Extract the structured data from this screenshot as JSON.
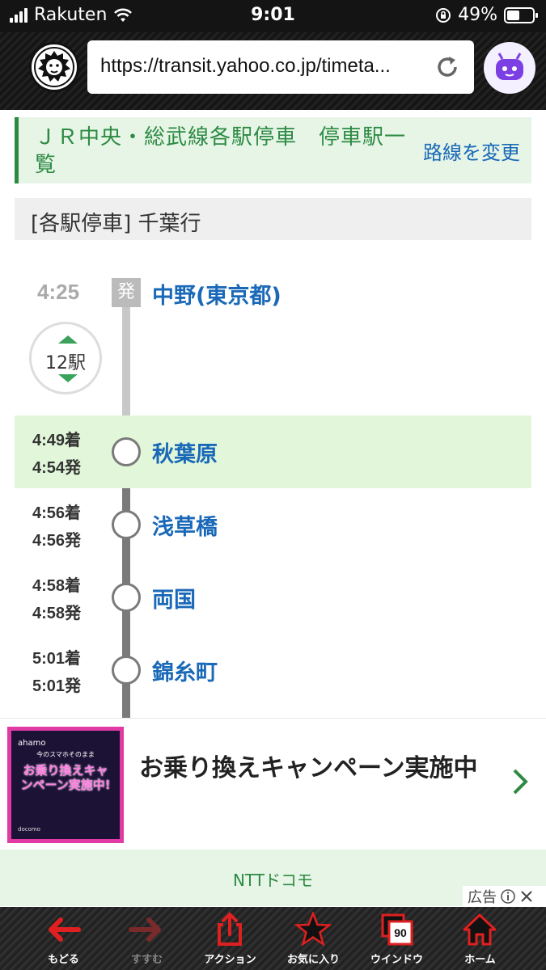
{
  "status_bar": {
    "carrier": "Rakuten",
    "time": "9:01",
    "battery": "49%",
    "battery_level": 0.49
  },
  "browser": {
    "url": "https://transit.yahoo.co.jp/timeta..."
  },
  "route": {
    "title": "ＪＲ中央・総武線各駅停車　停車駅一覧",
    "change_link": "路線を変更",
    "direction": "[各駅停車]  千葉行"
  },
  "departure": {
    "time": "4:25",
    "badge": "発",
    "station": "中野(東京都)",
    "stop_count": "12駅"
  },
  "stops": [
    {
      "arr": "4:49着",
      "dep": "4:54発",
      "name": "秋葉原",
      "highlight": true
    },
    {
      "arr": "4:56着",
      "dep": "4:56発",
      "name": "浅草橋",
      "highlight": false
    },
    {
      "arr": "4:58着",
      "dep": "4:58発",
      "name": "両国",
      "highlight": false
    },
    {
      "arr": "5:01着",
      "dep": "5:01発",
      "name": "錦糸町",
      "highlight": false
    }
  ],
  "ad": {
    "image_brand": "ahamo",
    "image_sub": "今のスマホそのまま",
    "image_headline": "お乗り換えキャンペーン実施中!",
    "image_foot": "docomo",
    "title": "お乗り換えキャンペーン実施中",
    "sponsor": "NTTドコモ",
    "label": "広告"
  },
  "toolbar": {
    "back": "もどる",
    "forward": "すすむ",
    "action": "アクション",
    "favorites": "お気に入り",
    "windows": "ウインドウ",
    "windows_count": "90",
    "home": "ホーム"
  },
  "colors": {
    "route_green": "#2d8a43",
    "link_blue": "#1a69b8",
    "highlight_bg": "#e2f7d9",
    "toolbar_red": "#e02020"
  }
}
